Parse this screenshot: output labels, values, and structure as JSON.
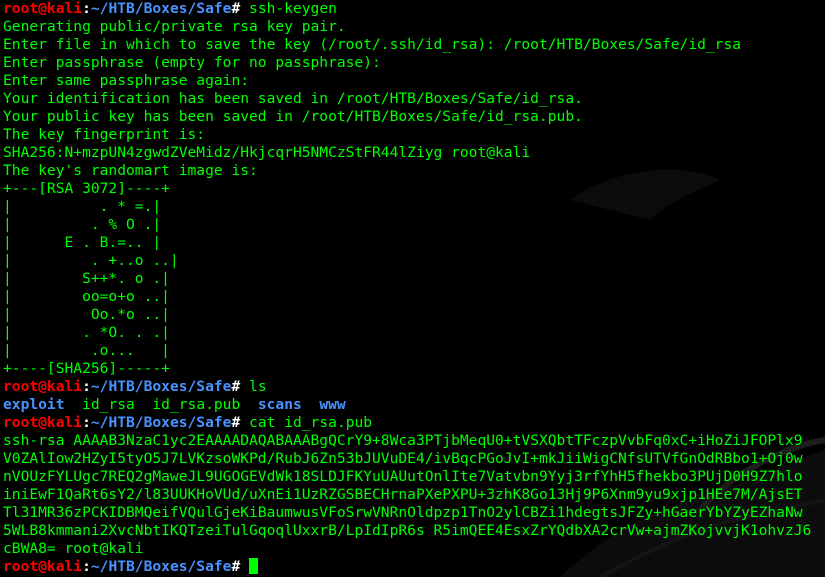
{
  "session": {
    "user_host": "root@kali",
    "separator": ":",
    "path": "~/HTB/Boxes/Safe",
    "prompt_symbol": "# "
  },
  "blocks": {
    "keygen": {
      "command": "ssh-keygen",
      "output": [
        "Generating public/private rsa key pair.",
        "Enter file in which to save the key (/root/.ssh/id_rsa): /root/HTB/Boxes/Safe/id_rsa",
        "Enter passphrase (empty for no passphrase):",
        "Enter same passphrase again:",
        "Your identification has been saved in /root/HTB/Boxes/Safe/id_rsa.",
        "Your public key has been saved in /root/HTB/Boxes/Safe/id_rsa.pub.",
        "The key fingerprint is:",
        "SHA256:N+mzpUN4zgwdZVeMidz/HkjcqrH5NMCzStFR44lZiyg root@kali",
        "The key's randomart image is:",
        "+---[RSA 3072]----+",
        "|          . * =.|",
        "|         . % O .|",
        "|      E . B.=.. |",
        "|         . +..o ..|",
        "|        S++*. o .|",
        "|        oo=o+o ..|",
        "|         Oo.*o ..|",
        "|        . *O. . .|",
        "|         .o...   |",
        "+----[SHA256]-----+"
      ]
    },
    "ls": {
      "command": "ls",
      "items": [
        "exploit",
        "id_rsa",
        "id_rsa.pub",
        "scans",
        "www"
      ]
    },
    "cat": {
      "command": "cat id_rsa.pub",
      "output": [
        "ssh-rsa AAAAB3NzaC1yc2EAAAADAQABAAABgQCrY9+8Wca3PTjbMeqU0+tVSXQbtTFczpVvbFq0xC+iHoZiJFOPlx9",
        "V0ZAlIow2HZyI5tyO5J7LVKzsoWKPd/RubJ6Zn53bJUVuDE4/ivBqcPGoJvI+mkJiiWigCNfsUTVfGnOdRBbo1+Oj0w",
        "nVOUzFYLUgc7REQ2gMaweJL9UGOGEVdWk18SLDJFKYuUAUutOnlIte7Vatvbn9Yyj3rfYhH5fhekbo3PUjD0H9Z7hlo",
        "iniEwF1QaRt6sY2/l83UUKHoVUd/uXnEi1UzRZGSBECHrnaPXePXPU+3zhK8Go13Hj9P6Xnm9yu9xjp1HEe7M/AjsET",
        "Tl31MR36zPCKIDBMQeifVQulGjeKiBaumwusVFoSrwVNRnOldpzp1TnO2ylCBZi1hdegtsJFZy+hGaerYbYZyEZhaNw",
        "5WLB8kmmani2XvcNbtIKQTzeiTulGqoqlUxxrB/LpIdIpR6s R5imQEE4EsxZrYQdbXA2crVw+ajmZKojvvjK1ohvzJ6",
        "cBWA8= root@kali"
      ]
    }
  }
}
